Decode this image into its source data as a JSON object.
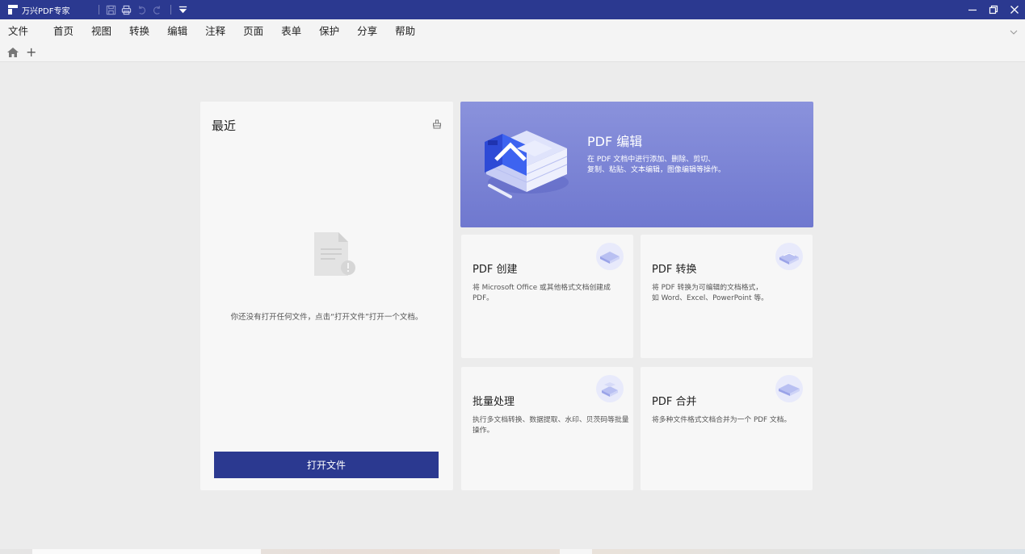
{
  "titlebar": {
    "app_title": "万兴PDF专家",
    "quick_actions": [
      "save-icon",
      "print-icon",
      "undo-icon",
      "redo-icon",
      "customize-dropdown-icon"
    ],
    "window_controls": [
      "minimize-icon",
      "restore-icon",
      "close-icon"
    ],
    "bg_color": "#2b3990"
  },
  "menubar": {
    "items": [
      "文件",
      "首页",
      "视图",
      "转换",
      "编辑",
      "注释",
      "页面",
      "表单",
      "保护",
      "分享",
      "帮助"
    ]
  },
  "tabbar": {
    "home_icon": "home-icon",
    "add_icon": "+"
  },
  "recent": {
    "title": "最近",
    "empty_text": "你还没有打开任何文件，点击“打开文件”打开一个文档。",
    "open_button": "打开文件"
  },
  "banner": {
    "title": "PDF 编辑",
    "desc_line1": "在 PDF 文档中进行添加、删除、剪切、",
    "desc_line2": "复制、粘贴、文本编辑，图像编辑等操作。"
  },
  "cards": [
    {
      "title": "PDF 创建",
      "desc": "将 Microsoft Office 或其他格式文档创建成 PDF。"
    },
    {
      "title": "PDF 转换",
      "desc_line1": "将 PDF 转换为可编辑的文档格式，",
      "desc_line2": "如 Word、Excel、PowerPoint 等。"
    },
    {
      "title": "批量处理",
      "desc": "执行多文档转换、数据提取、水印、贝茨码等批量操作。"
    },
    {
      "title": "PDF 合并",
      "desc": "将多种文件格式文档合并为一个 PDF 文档。"
    }
  ],
  "colors": {
    "accent": "#2b3990",
    "banner_top": "#8a92dc",
    "banner_bottom": "#6f78cf"
  }
}
